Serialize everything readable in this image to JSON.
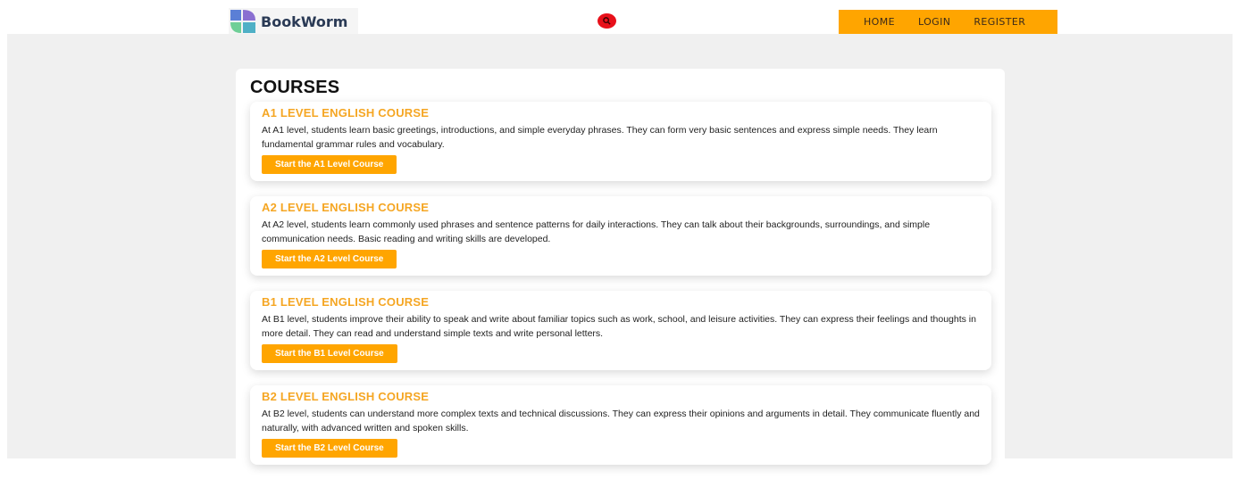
{
  "header": {
    "brand": "BookWorm",
    "search_icon": "search-icon",
    "nav": [
      {
        "label": "HOME"
      },
      {
        "label": "LOGIN"
      },
      {
        "label": "REGISTER"
      }
    ],
    "colors": {
      "nav_bg": "#ffa500",
      "search_bg": "#e8101a"
    }
  },
  "main": {
    "title": "COURSES",
    "courses": [
      {
        "title": "A1 LEVEL ENGLISH COURSE",
        "description": "At A1 level, students learn basic greetings, introductions, and simple everyday phrases. They can form very basic sentences and express simple needs. They learn fundamental grammar rules and vocabulary.",
        "button": "Start the A1 Level Course"
      },
      {
        "title": "A2 LEVEL ENGLISH COURSE",
        "description": "At A2 level, students learn commonly used phrases and sentence patterns for daily interactions. They can talk about their backgrounds, surroundings, and simple communication needs. Basic reading and writing skills are developed.",
        "button": "Start the A2 Level Course"
      },
      {
        "title": "B1 LEVEL ENGLISH COURSE",
        "description": "At B1 level, students improve their ability to speak and write about familiar topics such as work, school, and leisure activities. They can express their feelings and thoughts in more detail. They can read and understand simple texts and write personal letters.",
        "button": "Start the B1 Level Course"
      },
      {
        "title": "B2 LEVEL ENGLISH COURSE",
        "description": "At B2 level, students can understand more complex texts and technical discussions. They can express their opinions and arguments in detail. They communicate fluently and naturally, with advanced written and spoken skills.",
        "button": "Start the B2 Level Course"
      }
    ],
    "colors": {
      "accent": "#ffa500",
      "course_title": "#f5a623",
      "page_bg": "#f0f0f0"
    }
  }
}
